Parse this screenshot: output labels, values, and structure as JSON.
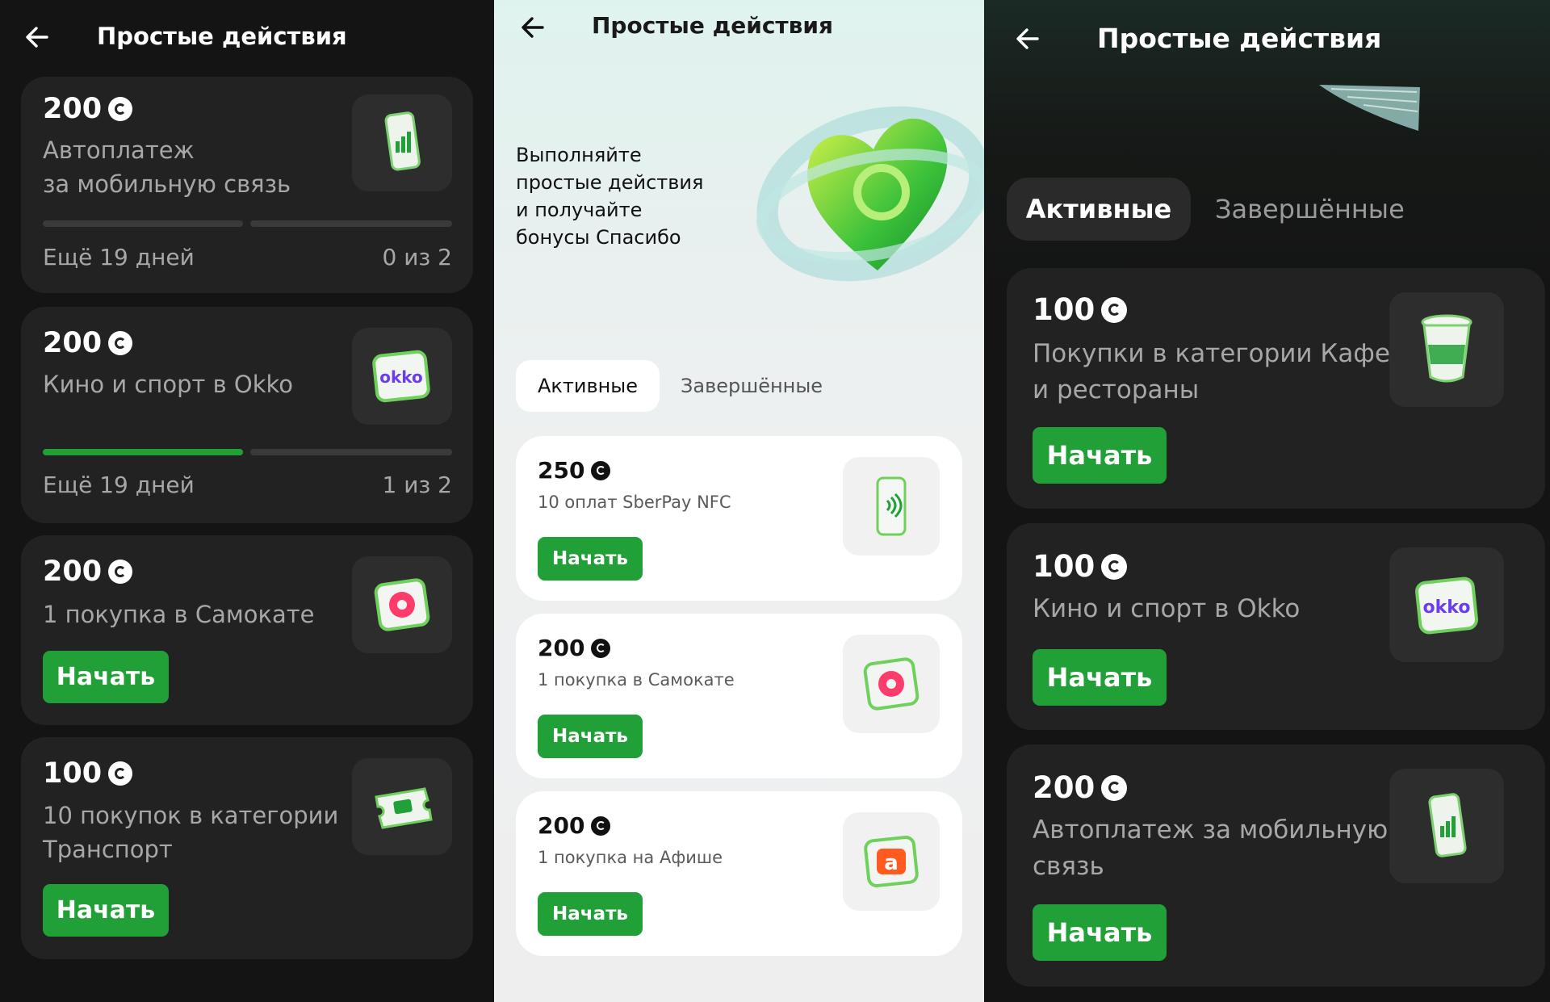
{
  "screens": [
    {
      "title": "Простые действия",
      "cards": [
        {
          "amount": "200",
          "desc1": "Автоплатеж",
          "desc2": "за мобильную связь",
          "icon": "phone-signal-icon",
          "progress": [
            0,
            0
          ],
          "days": "Ещё 19 дней",
          "count": "0 из 2"
        },
        {
          "amount": "200",
          "desc1": "Кино и спорт в Okko",
          "icon": "okko-logo-icon",
          "progress": [
            1,
            0
          ],
          "days": "Ещё 19 дней",
          "count": "1 из 2"
        },
        {
          "amount": "200",
          "desc1": "1 покупка в Самокате",
          "icon": "samokat-logo-icon",
          "button": "Начать"
        },
        {
          "amount": "100",
          "desc1": "10 покупок в категории",
          "desc2": "Транспорт",
          "icon": "bus-ticket-icon",
          "button": "Начать"
        }
      ]
    },
    {
      "title": "Простые действия",
      "promo": [
        "Выполняйте",
        "простые действия",
        "и получайте",
        "бонусы Спасибо"
      ],
      "tabs": {
        "active": "Активные",
        "done": "Завершённые"
      },
      "cards": [
        {
          "amount": "250",
          "desc1": "10 оплат SberPay NFC",
          "icon": "phone-nfc-icon",
          "button": "Начать"
        },
        {
          "amount": "200",
          "desc1": "1 покупка в Самокате",
          "icon": "samokat-logo-icon",
          "button": "Начать"
        },
        {
          "amount": "200",
          "desc1": "1 покупка на Афише",
          "icon": "afisha-logo-icon",
          "button": "Начать"
        }
      ]
    },
    {
      "title": "Простые действия",
      "tabs": {
        "active": "Активные",
        "done": "Завершённые"
      },
      "cards": [
        {
          "amount": "100",
          "desc1": "Покупки в категории Кафе",
          "desc2": "и рестораны",
          "icon": "coffee-cup-icon",
          "button": "Начать"
        },
        {
          "amount": "100",
          "desc1": "Кино и спорт в Okko",
          "icon": "okko-logo-icon",
          "button": "Начать"
        },
        {
          "amount": "200",
          "desc1": "Автоплатеж за мобильную",
          "desc2": "связь",
          "icon": "phone-signal-icon",
          "button": "Начать"
        }
      ]
    }
  ],
  "colors": {
    "accent": "#21a038",
    "dark_card": "#222223",
    "dark_bg": "#141414"
  }
}
